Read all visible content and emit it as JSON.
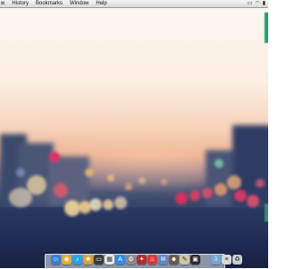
{
  "menubar": {
    "items": [
      {
        "label": "w"
      },
      {
        "label": "History"
      },
      {
        "label": "Bookmarks"
      },
      {
        "label": "Window"
      },
      {
        "label": "Help"
      }
    ],
    "status_icons": [
      "airplay-icon",
      "wifi-icon",
      "battery-icon"
    ]
  },
  "dock": {
    "apps": [
      {
        "name": "finder-icon",
        "color": "#3b7fd6",
        "glyph": "☺"
      },
      {
        "name": "chrome-icon",
        "color": "#e2ae2d",
        "glyph": "◉"
      },
      {
        "name": "itunes-icon",
        "color": "#2aa3e8",
        "glyph": "♪"
      },
      {
        "name": "photos-icon",
        "color": "#d7a23a",
        "glyph": "❀"
      },
      {
        "name": "terminal-icon",
        "color": "#3a3a3a",
        "glyph": "▭"
      },
      {
        "name": "calendar-icon",
        "color": "#e8e8e8",
        "glyph": "▦"
      },
      {
        "name": "app-store-icon",
        "color": "#2f8cf0",
        "glyph": "A"
      },
      {
        "name": "system-preferences-icon",
        "color": "#8a8a8a",
        "glyph": "⚙"
      },
      {
        "name": "photo-booth-icon",
        "color": "#b32c2c",
        "glyph": "✦"
      },
      {
        "name": "popcorn-icon",
        "color": "#d63a3a",
        "glyph": "♨"
      },
      {
        "name": "mail-icon",
        "color": "#5d88c8",
        "glyph": "✉"
      },
      {
        "name": "user-icon",
        "color": "#6b5a4a",
        "glyph": "☻"
      },
      {
        "name": "notes-icon",
        "color": "#cfc6a8",
        "glyph": "✎"
      },
      {
        "name": "monitor-icon",
        "color": "#2b2b2b",
        "glyph": "▣"
      }
    ],
    "right": [
      {
        "name": "downloads-icon",
        "color": "#6fa7d8",
        "glyph": "⇩"
      },
      {
        "name": "documents-icon",
        "color": "#d9d9d9",
        "glyph": "≡"
      },
      {
        "name": "trash-icon",
        "color": "#c8ccd2",
        "glyph": "♻"
      }
    ]
  }
}
